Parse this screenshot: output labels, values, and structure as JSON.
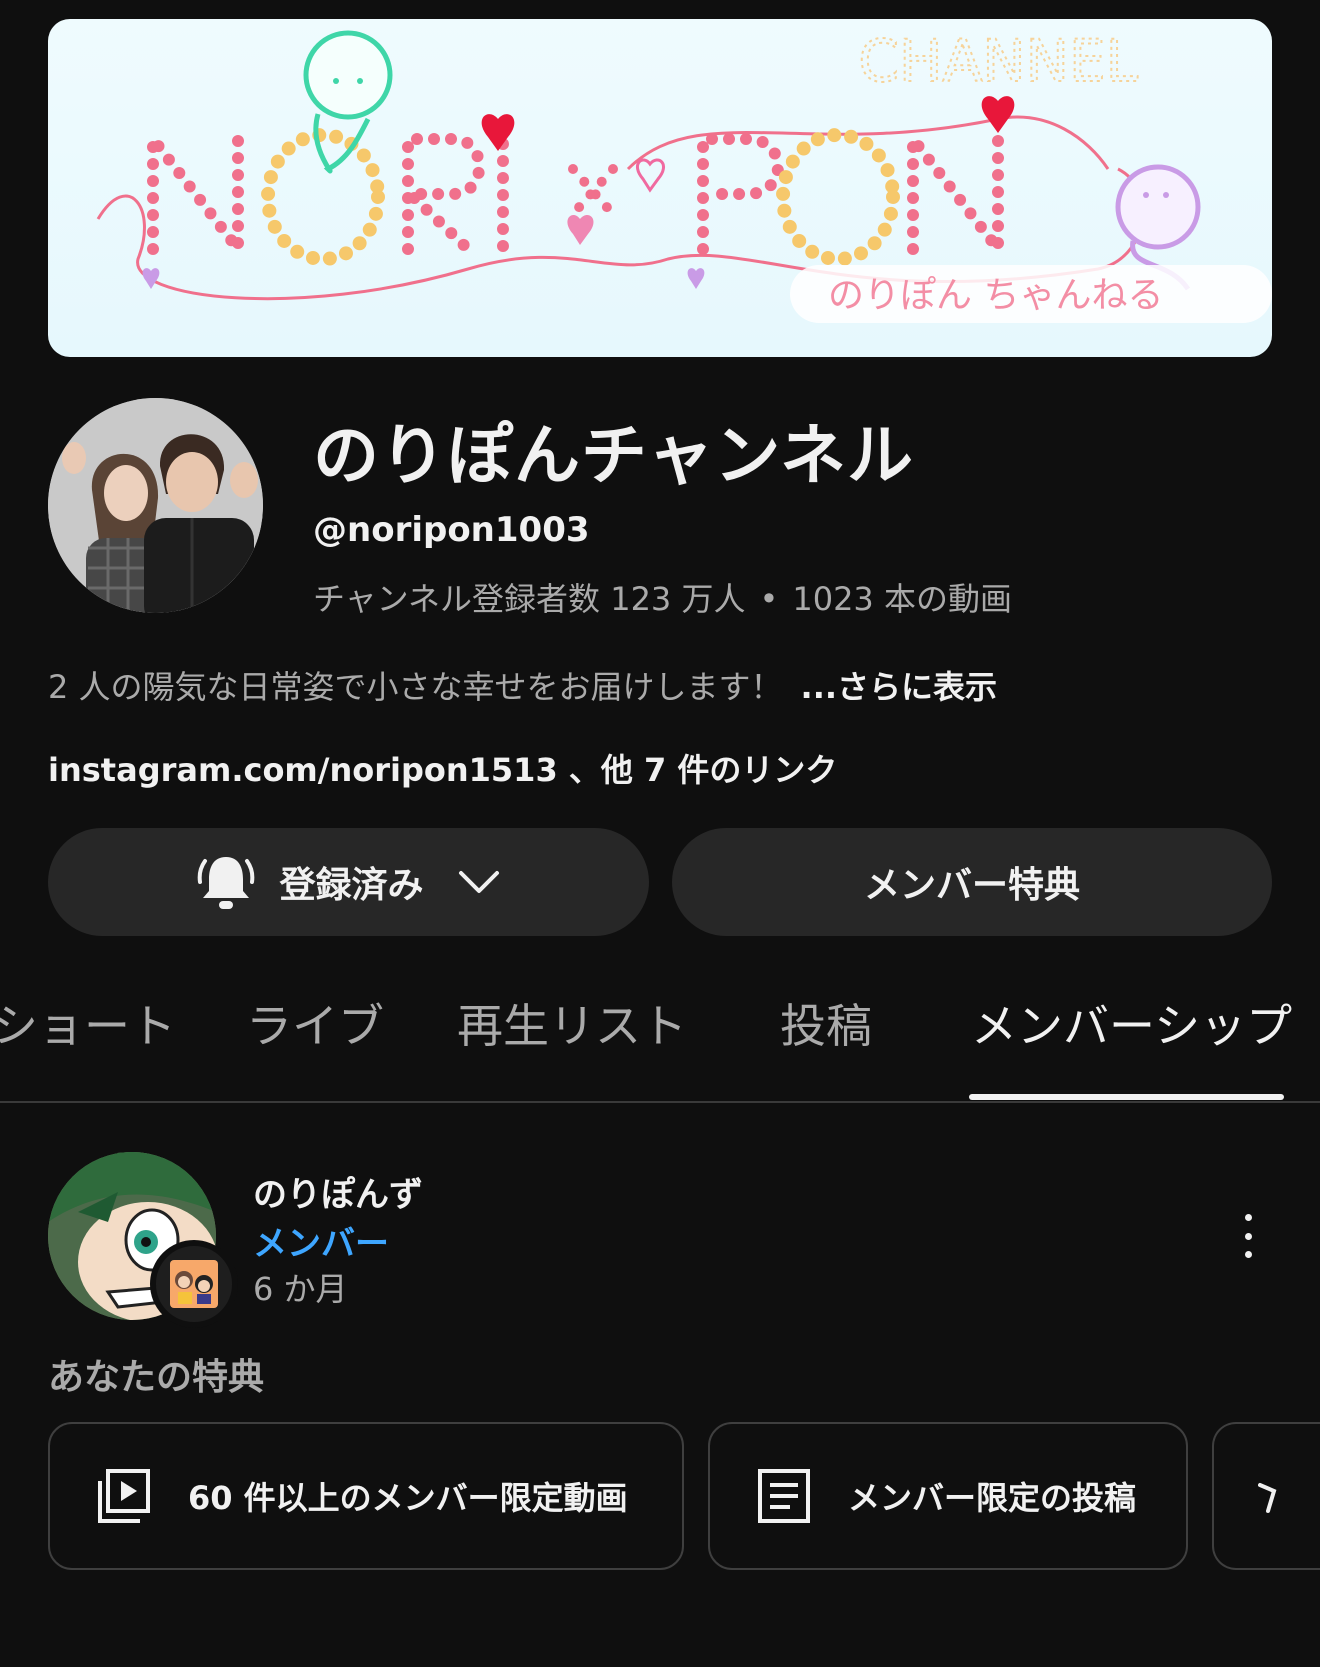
{
  "banner": {
    "brand_left": "NORI",
    "brand_x": "x",
    "brand_right": "PON",
    "corner_text": "CHANNEL",
    "tagline": "のりぽん ちゃんねる"
  },
  "channel": {
    "name": "のりぽんチャンネル",
    "handle": "@noripon1003",
    "subscribers": "チャンネル登録者数 123 万人",
    "separator": "•",
    "videos": "1023 本の動画",
    "description": "2 人の陽気な日常姿で小さな幸せをお届けします！",
    "more_label": "...さらに表示",
    "links": "instagram.com/noripon1513 、他 7 件のリンク"
  },
  "buttons": {
    "subscribed_label": "登録済み",
    "subscribed_icon": "bell-icon",
    "dropdown_icon": "chevron-down-icon",
    "membership_label": "メンバー特典"
  },
  "tabs": [
    {
      "label": "ショート",
      "active": false
    },
    {
      "label": "ライブ",
      "active": false
    },
    {
      "label": "再生リスト",
      "active": false
    },
    {
      "label": "投稿",
      "active": false
    },
    {
      "label": "メンバーシップ",
      "active": true
    }
  ],
  "membership": {
    "name": "のりぽんず",
    "level": "メンバー",
    "duration": "6 か月",
    "menu_icon": "more-vertical-icon",
    "perks_title": "あなたの特典",
    "perks": [
      {
        "label": "60 件以上のメンバー限定動画",
        "icon": "video-library-icon"
      },
      {
        "label": "メンバー限定の投稿",
        "icon": "post-icon"
      },
      {
        "label": "",
        "icon": "emoji-icon"
      }
    ]
  },
  "colors": {
    "background": "#0f0f0f",
    "surface": "#272727",
    "text_primary": "#f1f1f1",
    "text_secondary": "#aaaaaa",
    "accent_blue": "#3ea6ff",
    "banner_bg": "#e9f9fd",
    "banner_pink": "#f0708c",
    "banner_heart": "#e8173a"
  }
}
